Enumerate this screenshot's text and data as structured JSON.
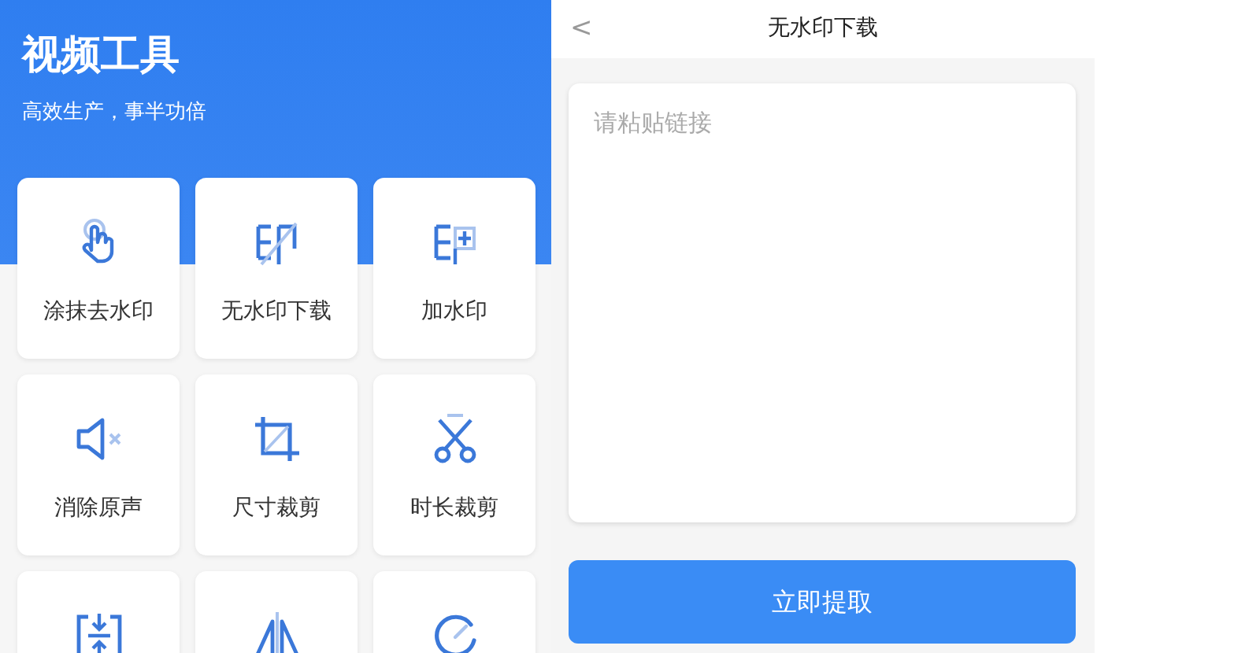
{
  "tools_page": {
    "title": "视频工具",
    "subtitle": "高效生产，事半功倍",
    "tools": [
      {
        "kind": "hand",
        "label": "涂抹去水印"
      },
      {
        "kind": "stamp-slash",
        "label": "无水印下载"
      },
      {
        "kind": "stamp-plus",
        "label": "加水印"
      },
      {
        "kind": "mute",
        "label": "消除原声"
      },
      {
        "kind": "crop",
        "label": "尺寸裁剪"
      },
      {
        "kind": "scissors",
        "label": "时长裁剪"
      },
      {
        "kind": "compress"
      },
      {
        "kind": "mirror"
      },
      {
        "kind": "speed"
      }
    ]
  },
  "download_page": {
    "back": "<",
    "title": "无水印下载",
    "link_field": {
      "placeholder": "请粘贴链接"
    },
    "button": "立即提取"
  }
}
